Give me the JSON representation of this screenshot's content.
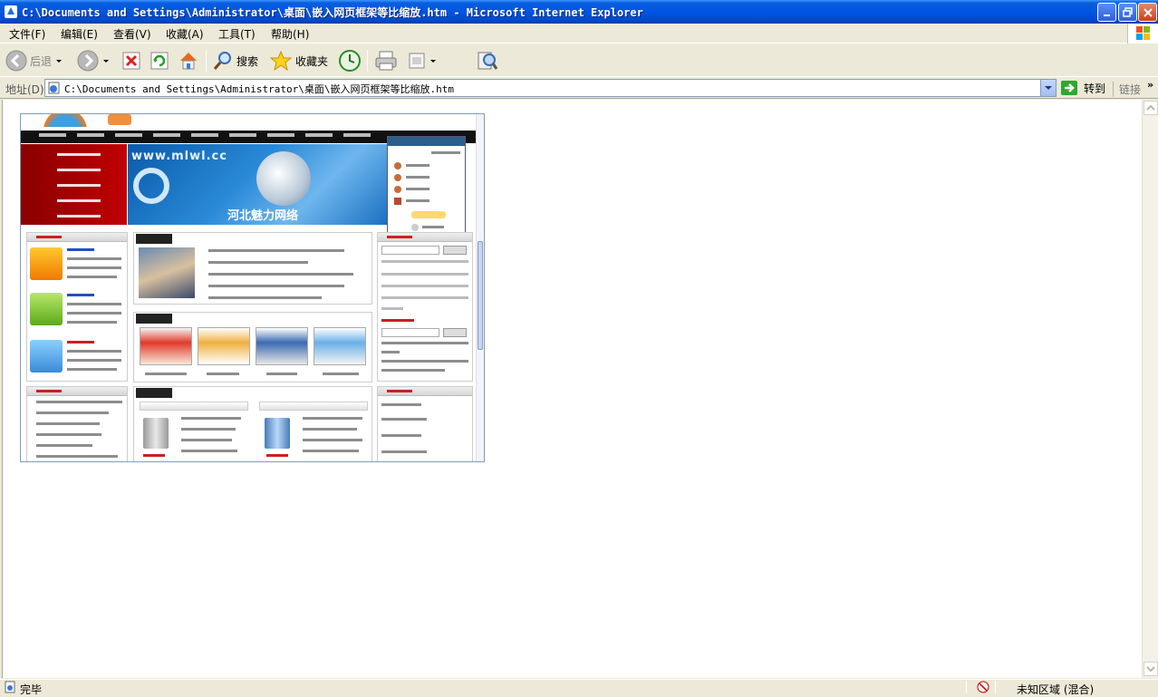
{
  "window": {
    "title": "C:\\Documents and Settings\\Administrator\\桌面\\嵌入网页框架等比缩放.htm - Microsoft Internet Explorer"
  },
  "menu": {
    "items": [
      "文件(F)",
      "编辑(E)",
      "查看(V)",
      "收藏(A)",
      "工具(T)",
      "帮助(H)"
    ]
  },
  "toolbar": {
    "back_label": "后退",
    "search_label": "搜索",
    "favorites_label": "收藏夹"
  },
  "address": {
    "label": "地址(D)",
    "value": "C:\\Documents and Settings\\Administrator\\桌面\\嵌入网页框架等比缩放.htm",
    "go_label": "转到",
    "links_label": "链接"
  },
  "embedded": {
    "banner_text": "www.mlwl.cc",
    "banner_title": "河北魅力网络"
  },
  "status": {
    "text": "完毕",
    "zone": "未知区域 (混合)"
  }
}
